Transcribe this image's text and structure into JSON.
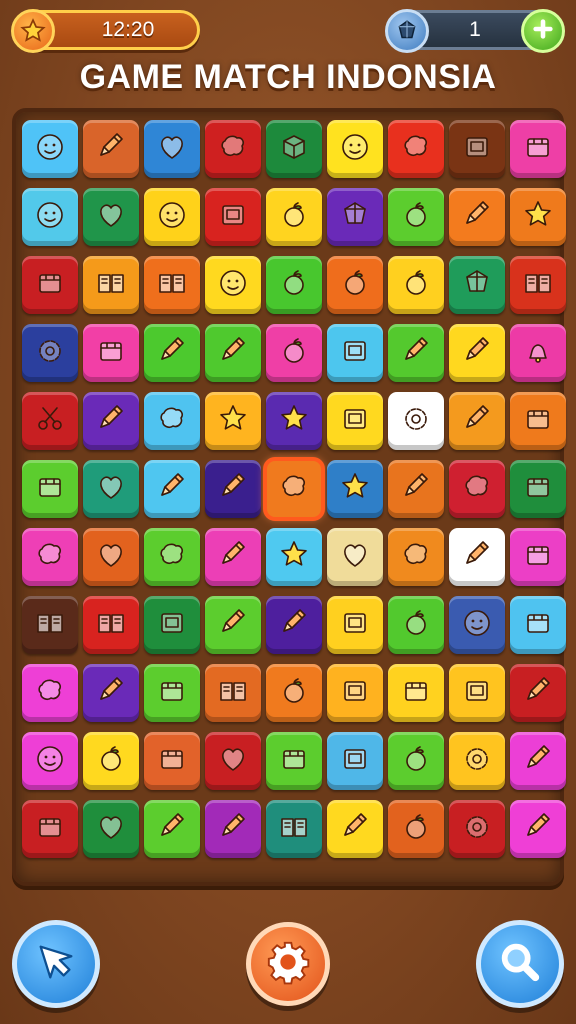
{
  "header": {
    "timer": "12:20",
    "timer_icon": "star-icon",
    "coins": "1",
    "coin_icon": "gem-icon",
    "add_icon": "plus-icon"
  },
  "title": "GAME MATCH INDONSIA",
  "board": {
    "selected_tile": "5,4",
    "rows": [
      [
        {
          "color": "#4fc3f7",
          "icon": "face"
        },
        {
          "color": "#d9642a",
          "icon": "pencil"
        },
        {
          "color": "#2f86d6",
          "icon": "heart"
        },
        {
          "color": "#cf2020",
          "icon": "blob"
        },
        {
          "color": "#1d8a3c",
          "icon": "cube"
        },
        {
          "color": "#ffe21f",
          "icon": "face"
        },
        {
          "color": "#e8301e",
          "icon": "blob"
        },
        {
          "color": "#7a3414",
          "icon": "square"
        },
        {
          "color": "#ee3fa6",
          "icon": "box"
        }
      ],
      [
        {
          "color": "#52c9ea",
          "icon": "face"
        },
        {
          "color": "#20954a",
          "icon": "heart"
        },
        {
          "color": "#ffd21a",
          "icon": "face"
        },
        {
          "color": "#d8231f",
          "icon": "square"
        },
        {
          "color": "#ffd41f",
          "icon": "apple"
        },
        {
          "color": "#6a2ab8",
          "icon": "gem"
        },
        {
          "color": "#5ccd2e",
          "icon": "apple"
        },
        {
          "color": "#f37b1e",
          "icon": "pencil"
        },
        {
          "color": "#ef7a1c",
          "icon": "star"
        }
      ],
      [
        {
          "color": "#c81f22",
          "icon": "box"
        },
        {
          "color": "#f59a1a",
          "icon": "book"
        },
        {
          "color": "#ef6f1c",
          "icon": "book"
        },
        {
          "color": "#ffd91f",
          "icon": "face"
        },
        {
          "color": "#48c72e",
          "icon": "apple"
        },
        {
          "color": "#ef6d1c",
          "icon": "apple"
        },
        {
          "color": "#ffd01f",
          "icon": "apple"
        },
        {
          "color": "#1f9c5a",
          "icon": "gem"
        },
        {
          "color": "#d8321c",
          "icon": "book"
        }
      ],
      [
        {
          "color": "#2b3f9e",
          "icon": "gear"
        },
        {
          "color": "#f23fa6",
          "icon": "box"
        },
        {
          "color": "#4cc92e",
          "icon": "pencil"
        },
        {
          "color": "#4fc92e",
          "icon": "pencil"
        },
        {
          "color": "#ef3fa6",
          "icon": "apple"
        },
        {
          "color": "#4dc6ee",
          "icon": "square"
        },
        {
          "color": "#54c92e",
          "icon": "pencil"
        },
        {
          "color": "#ffd81f",
          "icon": "pencil"
        },
        {
          "color": "#ed3aa6",
          "icon": "bell"
        }
      ],
      [
        {
          "color": "#c81f22",
          "icon": "scissors"
        },
        {
          "color": "#6a2ab8",
          "icon": "pencil"
        },
        {
          "color": "#4fc3f0",
          "icon": "blob"
        },
        {
          "color": "#ffb41f",
          "icon": "star"
        },
        {
          "color": "#5a2ab0",
          "icon": "star"
        },
        {
          "color": "#ffd91f",
          "icon": "square"
        },
        {
          "color": "#ffffff",
          "icon": "gear"
        },
        {
          "color": "#f49a1e",
          "icon": "pencil"
        },
        {
          "color": "#ef7a1c",
          "icon": "box"
        }
      ],
      [
        {
          "color": "#5ccd2e",
          "icon": "box"
        },
        {
          "color": "#1f9c7a",
          "icon": "heart"
        },
        {
          "color": "#4fc6f0",
          "icon": "pencil"
        },
        {
          "color": "#3a1f8e",
          "icon": "pencil"
        },
        {
          "color": "#f07a1e",
          "icon": "blob"
        },
        {
          "color": "#2f7fc8",
          "icon": "star"
        },
        {
          "color": "#e8741e",
          "icon": "pencil"
        },
        {
          "color": "#cf2030",
          "icon": "blob"
        },
        {
          "color": "#1f8e3c",
          "icon": "box"
        }
      ],
      [
        {
          "color": "#ee3fb6",
          "icon": "blob"
        },
        {
          "color": "#e2621e",
          "icon": "heart"
        },
        {
          "color": "#5ccd2e",
          "icon": "blob"
        },
        {
          "color": "#ec3fb6",
          "icon": "pencil"
        },
        {
          "color": "#4fc9f0",
          "icon": "star"
        },
        {
          "color": "#f0dc9a",
          "icon": "heart"
        },
        {
          "color": "#f08a1e",
          "icon": "blob"
        },
        {
          "color": "#ffffff",
          "icon": "pencil"
        },
        {
          "color": "#ec3fc6",
          "icon": "box"
        }
      ],
      [
        {
          "color": "#5a2a1a",
          "icon": "book"
        },
        {
          "color": "#d8231f",
          "icon": "book"
        },
        {
          "color": "#1f8e3c",
          "icon": "square"
        },
        {
          "color": "#5ccd2e",
          "icon": "pencil"
        },
        {
          "color": "#4e1f9e",
          "icon": "pencil"
        },
        {
          "color": "#ffd01f",
          "icon": "square"
        },
        {
          "color": "#52c92e",
          "icon": "apple"
        },
        {
          "color": "#3a5bb0",
          "icon": "face"
        },
        {
          "color": "#4fc3f0",
          "icon": "box"
        }
      ],
      [
        {
          "color": "#ee3fd6",
          "icon": "blob"
        },
        {
          "color": "#6a2ab8",
          "icon": "pencil"
        },
        {
          "color": "#5ccd2e",
          "icon": "box"
        },
        {
          "color": "#e36a22",
          "icon": "book"
        },
        {
          "color": "#f07a1e",
          "icon": "apple"
        },
        {
          "color": "#ffb21f",
          "icon": "square"
        },
        {
          "color": "#ffd21f",
          "icon": "box"
        },
        {
          "color": "#ffc41f",
          "icon": "square"
        },
        {
          "color": "#c81f22",
          "icon": "pencil"
        }
      ],
      [
        {
          "color": "#ee3fd6",
          "icon": "face"
        },
        {
          "color": "#ffd91f",
          "icon": "apple"
        },
        {
          "color": "#e2622a",
          "icon": "box"
        },
        {
          "color": "#c81f22",
          "icon": "heart"
        },
        {
          "color": "#5ccd2e",
          "icon": "box"
        },
        {
          "color": "#4fb7e8",
          "icon": "square"
        },
        {
          "color": "#5ccd2e",
          "icon": "apple"
        },
        {
          "color": "#ffc41f",
          "icon": "gear"
        },
        {
          "color": "#ec3fd6",
          "icon": "pencil"
        }
      ],
      [
        {
          "color": "#c81f22",
          "icon": "box"
        },
        {
          "color": "#1f8e3c",
          "icon": "heart"
        },
        {
          "color": "#5ccd2e",
          "icon": "pencil"
        },
        {
          "color": "#a22ab8",
          "icon": "pencil"
        },
        {
          "color": "#1f8e7c",
          "icon": "book"
        },
        {
          "color": "#ffd91f",
          "icon": "pencil"
        },
        {
          "color": "#e2621e",
          "icon": "apple"
        },
        {
          "color": "#c81f22",
          "icon": "gear"
        },
        {
          "color": "#ef3fd6",
          "icon": "pencil"
        }
      ]
    ]
  },
  "buttons": {
    "back_icon": "back-arrow-icon",
    "settings_icon": "gear-icon",
    "search_icon": "search-icon"
  }
}
